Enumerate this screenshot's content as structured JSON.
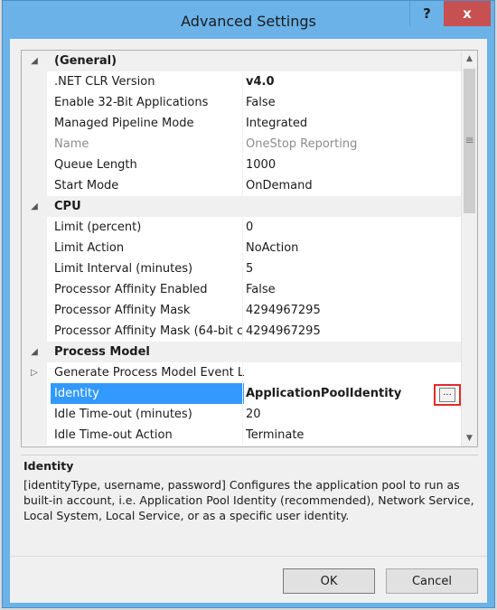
{
  "window": {
    "title": "Advanced Settings",
    "help_label": "?",
    "close_label": "x"
  },
  "grid": {
    "rows": [
      {
        "kind": "category",
        "caret": "◢",
        "name": "(General)"
      },
      {
        "kind": "prop",
        "name": ".NET CLR Version",
        "value": "v4.0",
        "bold_value": true
      },
      {
        "kind": "prop",
        "name": "Enable 32-Bit Applications",
        "value": "False"
      },
      {
        "kind": "prop",
        "name": "Managed Pipeline Mode",
        "value": "Integrated"
      },
      {
        "kind": "prop",
        "name": "Name",
        "value": "OneStop Reporting",
        "dim": true
      },
      {
        "kind": "prop",
        "name": "Queue Length",
        "value": "1000"
      },
      {
        "kind": "prop",
        "name": "Start Mode",
        "value": "OnDemand"
      },
      {
        "kind": "category",
        "caret": "◢",
        "name": "CPU"
      },
      {
        "kind": "prop",
        "name": "Limit (percent)",
        "value": "0"
      },
      {
        "kind": "prop",
        "name": "Limit Action",
        "value": "NoAction"
      },
      {
        "kind": "prop",
        "name": "Limit Interval (minutes)",
        "value": "5"
      },
      {
        "kind": "prop",
        "name": "Processor Affinity Enabled",
        "value": "False"
      },
      {
        "kind": "prop",
        "name": "Processor Affinity Mask",
        "value": "4294967295"
      },
      {
        "kind": "prop",
        "name": "Processor Affinity Mask (64-bit c",
        "value": "4294967295"
      },
      {
        "kind": "category",
        "caret": "◢",
        "name": "Process Model"
      },
      {
        "kind": "prop",
        "caret": "▷",
        "name": "Generate Process Model Event L",
        "value": ""
      },
      {
        "kind": "prop",
        "name": "Identity",
        "value": "ApplicationPoolIdentity",
        "selected": true,
        "ellipsis": "..."
      },
      {
        "kind": "prop",
        "name": "Idle Time-out (minutes)",
        "value": "20"
      },
      {
        "kind": "prop",
        "name": "Idle Time-out Action",
        "value": "Terminate"
      }
    ],
    "scroll_up_icon": "▲",
    "scroll_down_icon": "▼",
    "scroll_grip": "≡"
  },
  "description": {
    "title": "Identity",
    "text": "[identityType, username, password] Configures the application pool to run as built-in account, i.e. Application Pool Identity (recommended), Network Service, Local System, Local Service, or as a specific user identity."
  },
  "buttons": {
    "ok": "OK",
    "cancel": "Cancel"
  }
}
